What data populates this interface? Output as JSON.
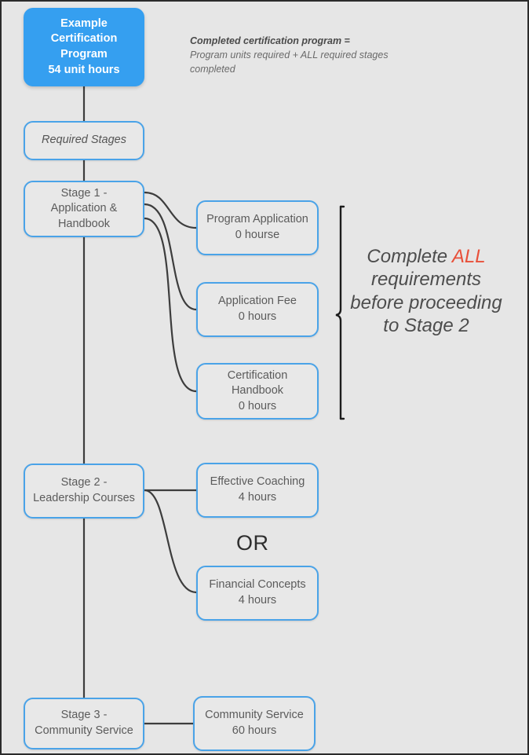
{
  "diagram": {
    "title": "Example Certification Program Flow",
    "background_color": "#e6e6e6",
    "accent_color": "#359ff0",
    "border_color": "#4aa3e8",
    "highlight_color": "#e8503a",
    "connector_color": "#3d3d3d"
  },
  "root": {
    "label": "Example\nCertification Program\n54 unit hours",
    "program_name": "Example Certification Program",
    "unit_hours": 54
  },
  "legend": {
    "heading": "Completed certification program =",
    "body": "Program units required + ALL required stages completed"
  },
  "stages_header": {
    "label": "Required Stages"
  },
  "stage1": {
    "label": "Stage 1 -\nApplication &\nHandbook",
    "name": "Stage 1 - Application & Handbook",
    "logic": "AND",
    "requirements": [
      {
        "label": "Program Application\n0 hourse",
        "name": "Program Application",
        "hours": "0 hourse"
      },
      {
        "label": "Application Fee\n0 hours",
        "name": "Application Fee",
        "hours": "0 hours"
      },
      {
        "label": "Certification Handbook\n0 hours",
        "name": "Certification Handbook",
        "hours": "0 hours"
      }
    ]
  },
  "brace_note": {
    "line1_pre": "Complete ",
    "line1_em": "ALL",
    "line2": "requirements",
    "line3": "before proceeding",
    "line4": "to Stage 2",
    "full_text": "Complete ALL requirements before proceeding to Stage 2"
  },
  "stage2": {
    "label": "Stage 2 -\nLeadership Courses",
    "name": "Stage 2 - Leadership Courses",
    "logic": "OR",
    "or_label": "OR",
    "requirements": [
      {
        "label": "Effective Coaching\n4 hours",
        "name": "Effective Coaching",
        "hours": "4 hours"
      },
      {
        "label": "Financial Concepts\n4 hours",
        "name": "Financial Concepts",
        "hours": "4 hours"
      }
    ]
  },
  "stage3": {
    "label": "Stage 3 -\nCommunity Service",
    "name": "Stage 3 - Community Service",
    "requirements": [
      {
        "label": "Community Service\n60 hours",
        "name": "Community Service",
        "hours": "60 hours"
      }
    ]
  }
}
